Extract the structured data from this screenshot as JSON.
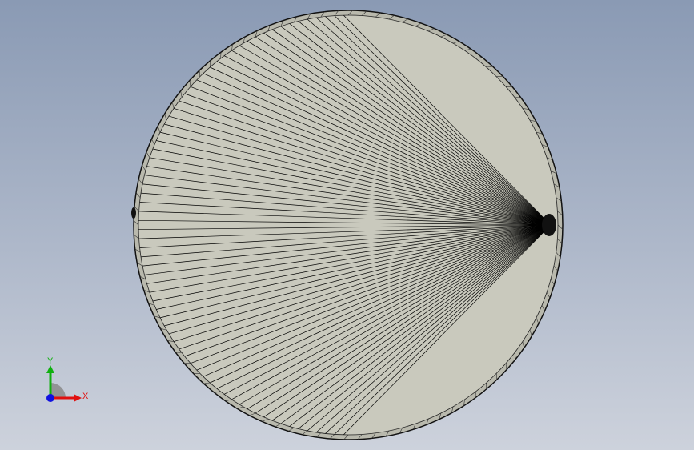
{
  "viewport": {
    "background_top": "#8a9ab4",
    "background_bottom": "#cdd2dc"
  },
  "model": {
    "name": "sphere",
    "face_color": "#c9c9bd",
    "edge_color": "#000000",
    "meridian_count": 72
  },
  "triad": {
    "x_label": "X",
    "y_label": "Y",
    "x_color": "#e01010",
    "y_color": "#10b010",
    "z_color": "#1010e0"
  }
}
